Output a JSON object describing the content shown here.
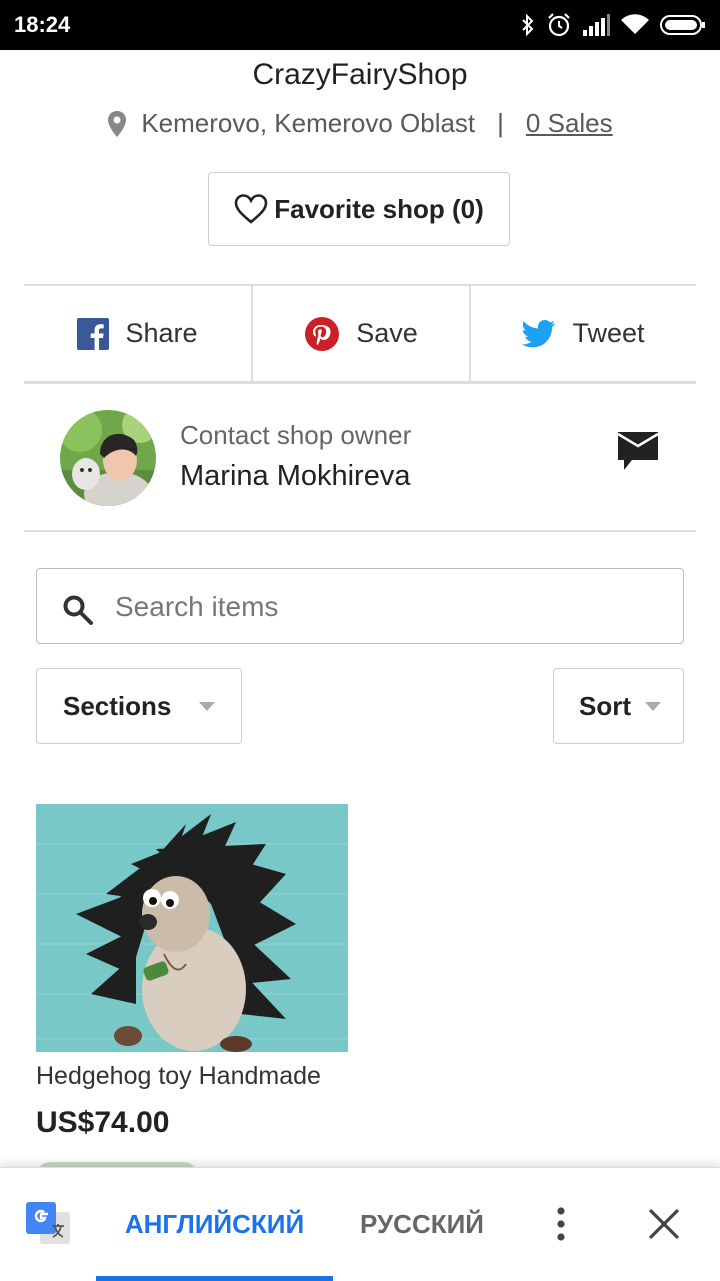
{
  "status_bar": {
    "time": "18:24"
  },
  "shop": {
    "name": "CrazyFairyShop",
    "location": "Kemerovo, Kemerovo Oblast",
    "divider": "|",
    "sales": "0 Sales",
    "favorite_label": "Favorite shop (0)"
  },
  "share": {
    "facebook": "Share",
    "pinterest": "Save",
    "twitter": "Tweet"
  },
  "owner": {
    "label": "Contact shop owner",
    "name": "Marina Mokhireva"
  },
  "search": {
    "placeholder": "Search items"
  },
  "filters": {
    "sections": "Sections",
    "sort": "Sort"
  },
  "listing": {
    "title": "Hedgehog toy Handmade",
    "price": "US$74.00"
  },
  "translate_bar": {
    "lang_active": "АНГЛИЙСКИЙ",
    "lang_other": "РУССКИЙ"
  },
  "colors": {
    "facebook": "#3b5998",
    "pinterest": "#cb2027",
    "twitter": "#1da1f2",
    "translate_accent": "#1a73e8"
  }
}
